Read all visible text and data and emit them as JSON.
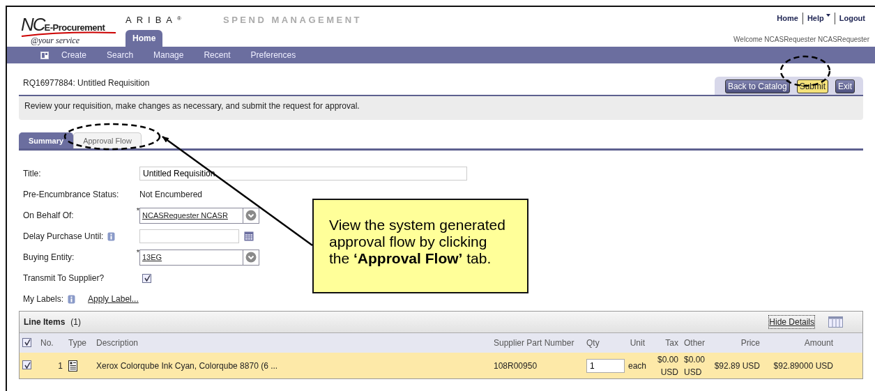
{
  "header": {
    "logo_initials": "NC",
    "logo_name": "E-Procurement",
    "logo_tagline": "@your service",
    "brand": "ARIBA",
    "brand_mark": "®",
    "product": "SPEND MANAGEMENT",
    "top_links": [
      {
        "label": "Home",
        "has_menu": false
      },
      {
        "label": "Help",
        "has_menu": true
      },
      {
        "label": "Logout",
        "has_menu": false
      }
    ],
    "welcome": "Welcome NCASRequester NCASRequester",
    "tabs": [
      {
        "label": "Home",
        "selected": true
      }
    ]
  },
  "nav": {
    "items": [
      "Create",
      "Search",
      "Manage",
      "Recent",
      "Preferences"
    ]
  },
  "page": {
    "title": "RQ16977884: Untitled Requisition",
    "buttons": [
      {
        "label": "Back to Catalog",
        "kind": "default"
      },
      {
        "label": "Submit",
        "kind": "primary"
      },
      {
        "label": "Exit",
        "kind": "default"
      }
    ],
    "message": "Review your requisition, make changes as necessary, and submit the request for approval."
  },
  "tabs": [
    {
      "label": "Summary",
      "selected": true
    },
    {
      "label": "Approval Flow",
      "selected": false
    }
  ],
  "form": {
    "fields": [
      {
        "label": "Title:",
        "kind": "text",
        "value": "Untitled Requisition"
      },
      {
        "label": "Pre-Encumbrance Status:",
        "kind": "static",
        "value": "Not Encumbered"
      },
      {
        "label": "On Behalf Of:",
        "kind": "chooser",
        "marker": "*",
        "value": "NCASRequester NCASR"
      },
      {
        "label": "Delay Purchase Until:",
        "kind": "date",
        "info": true
      },
      {
        "label": "Buying Entity:",
        "kind": "chooser",
        "marker": "*",
        "value": "13EG"
      },
      {
        "label": "Transmit To Supplier?",
        "kind": "checkbox",
        "checked": true
      },
      {
        "label": "My Labels:",
        "kind": "link",
        "info": true,
        "value": "Apply Label..."
      }
    ]
  },
  "line_items": {
    "title": "Line Items",
    "count": "(1)",
    "hide_details": "Hide Details",
    "all_checked": true,
    "columns": [
      "No.",
      "Type",
      "Description",
      "Supplier Part Number",
      "Qty",
      "Unit",
      "Tax",
      "Other",
      "Price",
      "Amount"
    ],
    "rows": [
      {
        "checked": true,
        "no": "1",
        "description": "Xerox Colorqube Ink Cyan, Colorqube 8870 (6 ...",
        "supplier_part": "108R00950",
        "qty": "1",
        "unit": "each",
        "tax": "$0.00 USD",
        "other": "$0.00 USD",
        "price": "$92.89 USD",
        "amount": "$92.89000 USD"
      }
    ]
  },
  "callout": {
    "text": "View the system generated approval flow by clicking the **‘Approval Flow’** tab."
  }
}
